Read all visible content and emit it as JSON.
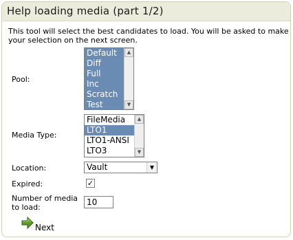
{
  "title": "Help loading media (part 1/2)",
  "intro": "This tool will select the best candidates to load. You will be asked to make your selection on the next screen.",
  "form": {
    "pool": {
      "label": "Pool:",
      "options": [
        "Default",
        "Diff",
        "Full",
        "Inc",
        "Scratch",
        "Test"
      ]
    },
    "media_type": {
      "label": "Media Type:",
      "options": [
        "FileMedia",
        "LTO1",
        "LTO1-ANSI",
        "LTO3"
      ],
      "selected": "LTO1"
    },
    "location": {
      "label": "Location:",
      "value": "Vault"
    },
    "expired": {
      "label": "Expired:",
      "checked": true
    },
    "number_of_media": {
      "label_line1": "Number of media",
      "label_line2": "to load:",
      "value": "10"
    }
  },
  "next_label": "Next",
  "colors": {
    "selection": "#6a8bb3",
    "header_bg": "#ececdc",
    "arrow_green": "#5e9a2e"
  },
  "icons": {
    "next": "green-right-arrow-icon"
  }
}
